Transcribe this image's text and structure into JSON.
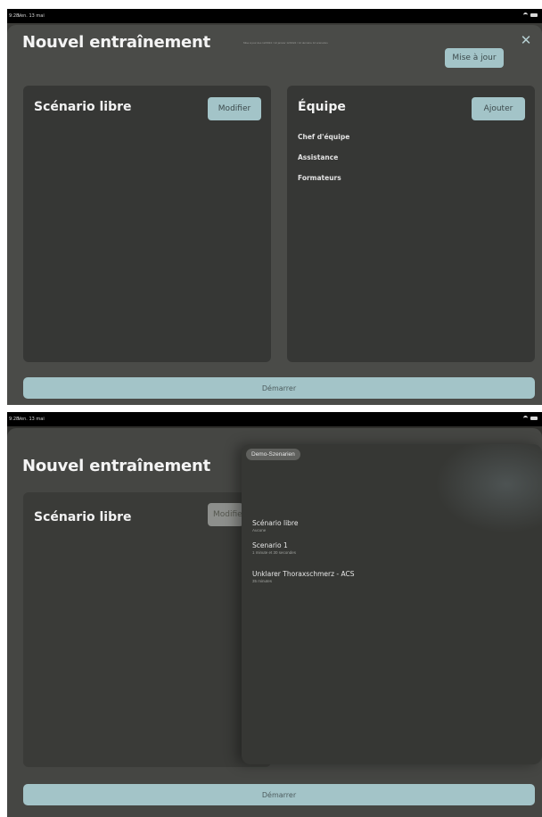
{
  "status_bar": {
    "time": "9:28",
    "date": "Ven. 13 mai"
  },
  "colors": {
    "accent": "#a3c4c8",
    "sheet_bg": "#4a4b48",
    "card_bg": "#363735",
    "status_bar": "#000000"
  },
  "screen1": {
    "title": "Nouvel entraînement",
    "hint": "Mise à jour des 12/2024 / 12 janvier 12/2024 / 12 dernière 12 scénarios",
    "update_button": "Mise à jour",
    "close_icon": "close-icon",
    "scenario_card": {
      "title": "Scénario libre",
      "modify_button": "Modifier"
    },
    "team_card": {
      "title": "Équipe",
      "add_button": "Ajouter",
      "roles": [
        "Chef d'équipe",
        "Assistance",
        "Formateurs"
      ]
    },
    "start_button": "Démarrer"
  },
  "screen2": {
    "title": "Nouvel entraînement",
    "scenario_card": {
      "title": "Scénario libre",
      "modify_button": "Modifier"
    },
    "popover": {
      "tag": "Demo-Szenarien",
      "items": [
        {
          "name": "Scénario libre",
          "sub": "Aucune"
        },
        {
          "name": "Scenario 1",
          "sub": "1 minute et 30 secondes"
        },
        {
          "name": "Unklarer Thoraxschmerz - ACS",
          "sub": "35 minutes"
        }
      ]
    },
    "start_button": "Démarrer"
  }
}
